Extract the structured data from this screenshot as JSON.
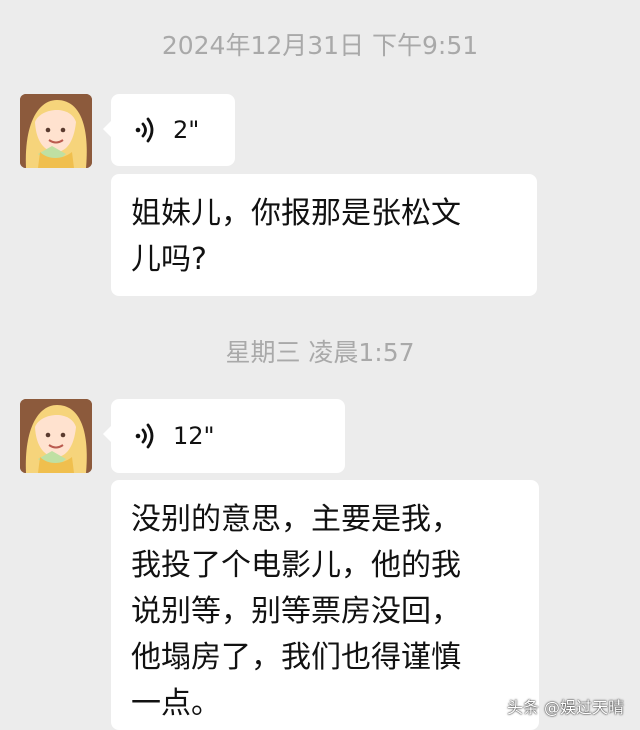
{
  "chat": {
    "messages": [
      {
        "timestamp": "2024年12月31日 下午9:51",
        "voice_duration": "2\"",
        "text": "姐妹儿，你报那是张松文\n儿吗?"
      },
      {
        "timestamp": "星期三 凌晨1:57",
        "voice_duration": "12\"",
        "text": "没别的意思，主要是我，\n我投了个电影儿，他的我\n说别等，别等票房没回，\n他塌房了，我们也得谨慎\n一点。"
      }
    ]
  },
  "watermark": "头条 @娱过天晴",
  "icons": {
    "avatar": "cartoon-girl-avatar",
    "voice": "voice-wave-icon"
  },
  "colors": {
    "background": "#ececec",
    "bubble": "#ffffff",
    "timestamp": "#a9a9a9"
  }
}
